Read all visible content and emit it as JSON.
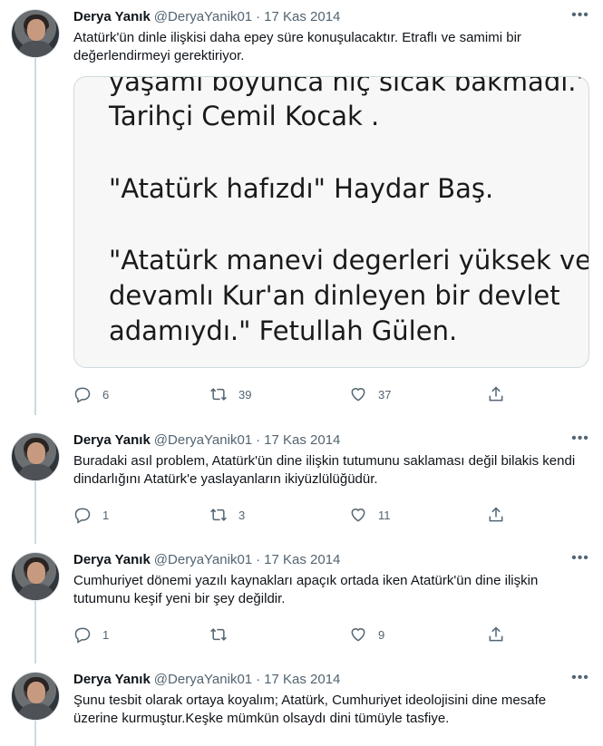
{
  "tweets": [
    {
      "name": "Derya Yanık",
      "handle": "@DeryaYanik01",
      "separator": "·",
      "date": "17 Kas 2014",
      "text": "Atatürk'ün dinle ilişkisi daha epey süre konuşulacaktır. Etraflı ve samimi bir değerlendirmeyi gerektiriyor.",
      "image_text": [
        "yaşamı boyunca hiç sıcak bakmadı.\"",
        "Tarihçi Cemil Kocak .",
        "\"Atatürk hafızdı\" Haydar Baş.",
        "\"Atatürk manevi degerleri yüksek ve",
        "devamlı Kur'an dinleyen bir devlet",
        "adamıydı.\" Fetullah Gülen."
      ],
      "replies": "6",
      "retweets": "39",
      "likes": "37"
    },
    {
      "name": "Derya Yanık",
      "handle": "@DeryaYanik01",
      "separator": "·",
      "date": "17 Kas 2014",
      "text": "Buradaki asıl problem, Atatürk'ün dine ilişkin tutumunu saklaması değil bilakis kendi dindarlığını Atatürk'e yaslayanların ikiyüzlülüğüdür.",
      "replies": "1",
      "retweets": "3",
      "likes": "11"
    },
    {
      "name": "Derya Yanık",
      "handle": "@DeryaYanik01",
      "separator": "·",
      "date": "17 Kas 2014",
      "text": "Cumhuriyet dönemi yazılı kaynakları apaçık ortada iken Atatürk'ün dine ilişkin tutumunu keşif yeni bir şey değildir.",
      "replies": "1",
      "retweets": "",
      "likes": "9"
    },
    {
      "name": "Derya Yanık",
      "handle": "@DeryaYanik01",
      "separator": "·",
      "date": "17 Kas 2014",
      "text": "Şunu tesbit olarak ortaya koyalım; Atatürk, Cumhuriyet ideolojisini dine mesafe üzerine kurmuştur.Keşke mümkün olsaydı dini tümüyle tasfiye."
    }
  ],
  "icons": {
    "more": "more-horizontal-icon",
    "reply": "reply-icon",
    "retweet": "retweet-icon",
    "like": "heart-icon",
    "share": "share-icon"
  },
  "colors": {
    "text": "#0f1419",
    "secondary": "#536471",
    "thread_line": "#cfd9de"
  }
}
